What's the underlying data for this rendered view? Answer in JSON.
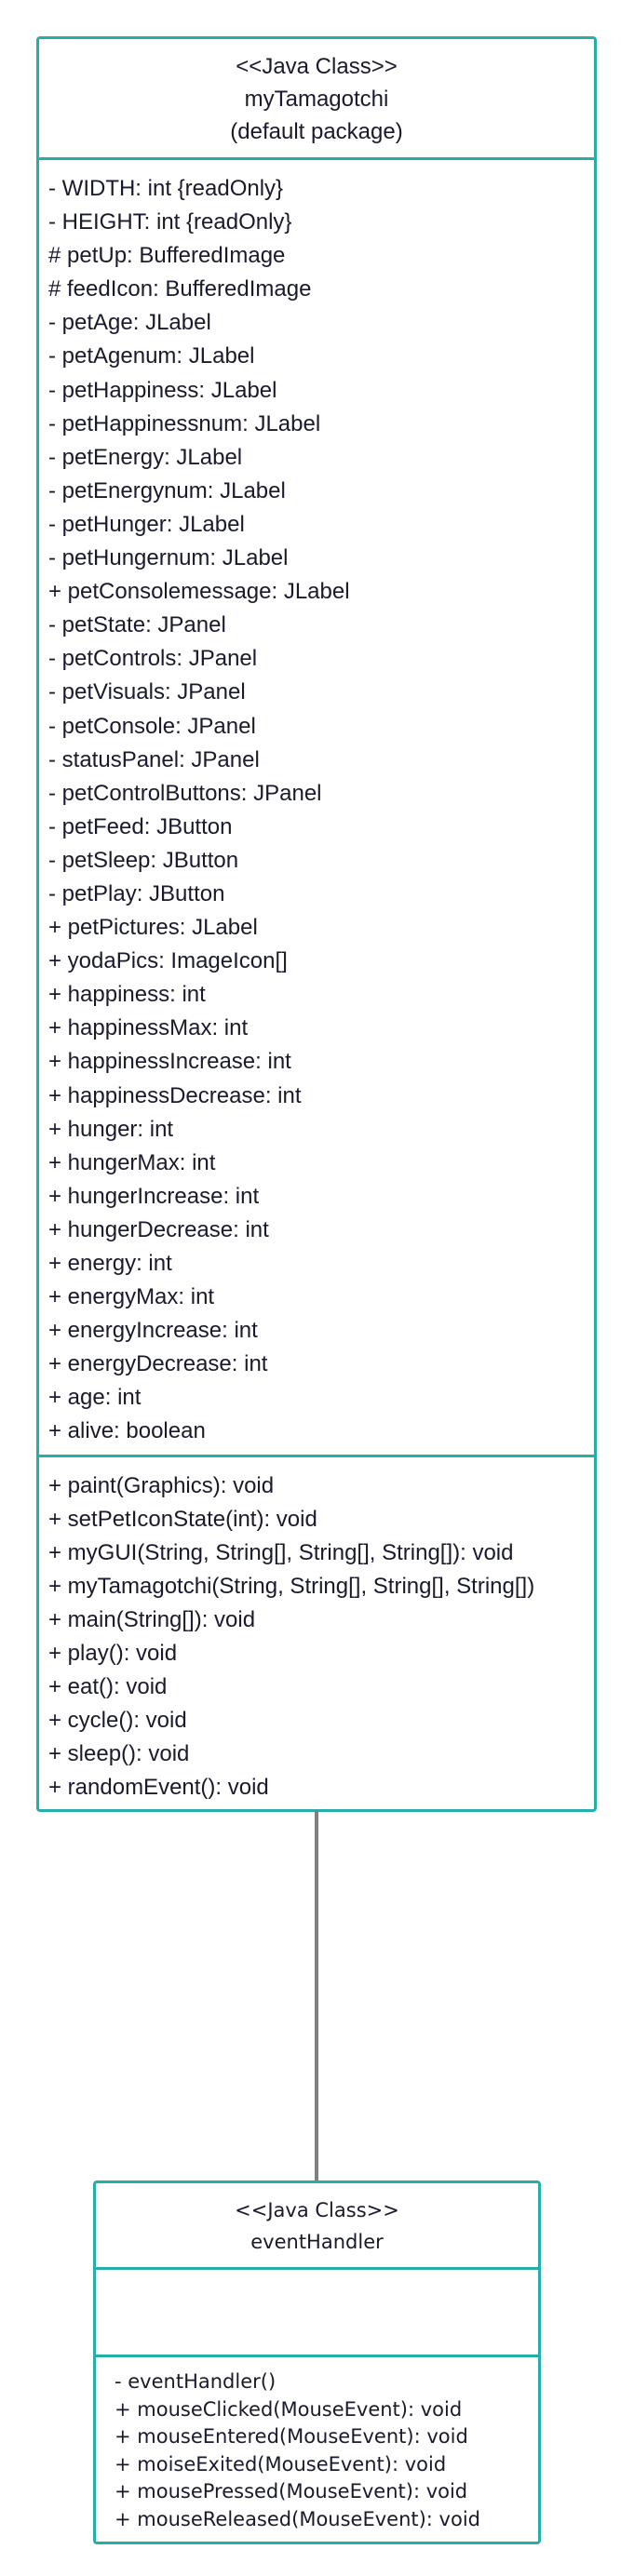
{
  "colors": {
    "border": "#26AFA9",
    "connector": "#808080"
  },
  "classes": [
    {
      "stereotype": "<<Java Class>>",
      "name": "myTamagotchi",
      "package": "(default package)",
      "attributes": [
        "- WIDTH: int {readOnly}",
        "- HEIGHT: int {readOnly}",
        "# petUp: BufferedImage",
        "# feedIcon: BufferedImage",
        "-  petAge: JLabel",
        "-  petAgenum: JLabel",
        "-  petHappiness: JLabel",
        "-  petHappinessnum: JLabel",
        "-  petEnergy: JLabel",
        "-  petEnergynum: JLabel",
        "-  petHunger: JLabel",
        "-  petHungernum: JLabel",
        "+ petConsolemessage: JLabel",
        "-  petState: JPanel",
        "-  petControls: JPanel",
        "-  petVisuals: JPanel",
        "-  petConsole: JPanel",
        "-  statusPanel: JPanel",
        "-  petControlButtons: JPanel",
        "-  petFeed: JButton",
        "-  petSleep: JButton",
        "-  petPlay: JButton",
        "+ petPictures: JLabel",
        "+ yodaPics: ImageIcon[]",
        "+ happiness: int",
        "+ happinessMax: int",
        "+ happinessIncrease: int",
        "+ happinessDecrease: int",
        "+ hunger: int",
        "+ hungerMax: int",
        "+ hungerIncrease: int",
        "+ hungerDecrease: int",
        "+ energy: int",
        "+ energyMax: int",
        "+ energyIncrease: int",
        "+ energyDecrease: int",
        "+ age: int",
        "+ alive: boolean"
      ],
      "methods": [
        "+  paint(Graphics): void",
        "+  setPetIconState(int): void",
        "+  myGUI(String, String[], String[], String[]): void",
        "+  myTamagotchi(String, String[], String[], String[])",
        "+  main(String[]): void",
        "+  play(): void",
        "+  eat(): void",
        "+  cycle(): void",
        "+  sleep(): void",
        "+  randomEvent(): void"
      ]
    },
    {
      "stereotype": "<<Java Class>>",
      "name": "eventHandler",
      "attributes": [],
      "methods": [
        "-   eventHandler()",
        "+  mouseClicked(MouseEvent): void",
        "+  mouseEntered(MouseEvent): void",
        "+  moiseExited(MouseEvent): void",
        "+  mousePressed(MouseEvent): void",
        "+  mouseReleased(MouseEvent): void"
      ]
    }
  ]
}
